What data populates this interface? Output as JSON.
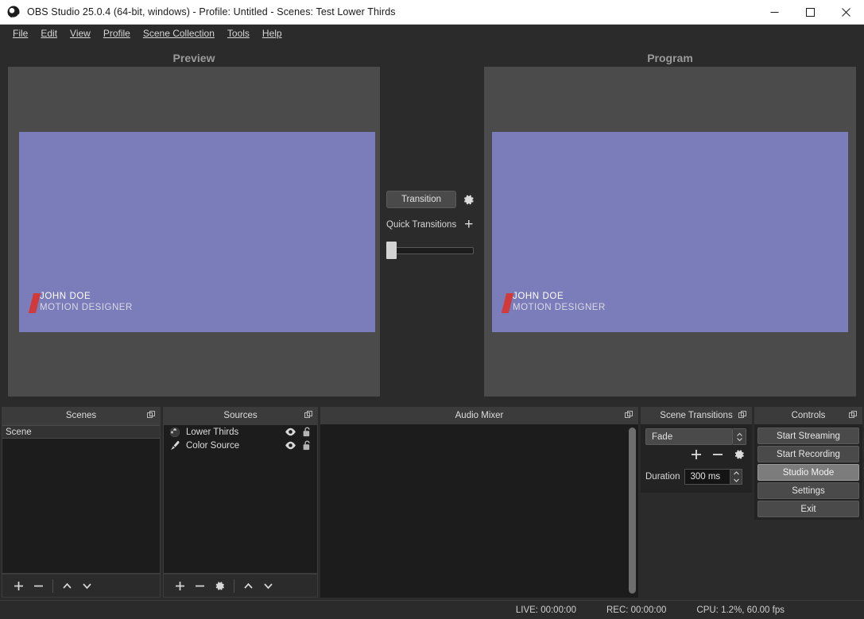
{
  "window": {
    "title": "OBS Studio 25.0.4 (64-bit, windows) - Profile: Untitled - Scenes: Test Lower Thirds",
    "logo_icon": "obs-logo-icon",
    "minimize_label": "─",
    "maximize_label": "□",
    "close_label": "✕"
  },
  "menu": {
    "items": [
      {
        "label": "File"
      },
      {
        "label": "Edit"
      },
      {
        "label": "View"
      },
      {
        "label": "Profile"
      },
      {
        "label": "Scene Collection"
      },
      {
        "label": "Tools"
      },
      {
        "label": "Help"
      }
    ]
  },
  "studio": {
    "preview_label": "Preview",
    "program_label": "Program",
    "canvas_color": "#7b7cba",
    "lower_third": {
      "name": "JOHN DOE",
      "role": "MOTION DESIGNER",
      "accent_color": "#d13a3a"
    }
  },
  "transition_center": {
    "transition_button": "Transition",
    "settings_icon": "gear-icon",
    "quick_transitions_label": "Quick Transitions",
    "add_icon": "plus-icon",
    "tbar_value": 0
  },
  "scenes": {
    "title": "Scenes",
    "float_icon": "undock-icon",
    "items": [
      {
        "label": "Scene",
        "selected": true
      }
    ],
    "toolbar": {
      "add": "+",
      "remove": "−",
      "move_up": "up-chevron-icon",
      "move_down": "down-chevron-icon"
    }
  },
  "sources": {
    "title": "Sources",
    "float_icon": "undock-icon",
    "items": [
      {
        "label": "Lower Thirds",
        "icon": "globe-icon",
        "visible": true,
        "locked": false
      },
      {
        "label": "Color Source",
        "icon": "brush-icon",
        "visible": true,
        "locked": false
      }
    ],
    "toolbar": {
      "add": "+",
      "remove": "−",
      "properties": "gear-icon",
      "move_up": "up-chevron-icon",
      "move_down": "down-chevron-icon"
    }
  },
  "mixer": {
    "title": "Audio Mixer",
    "float_icon": "undock-icon"
  },
  "scene_transitions": {
    "title": "Scene Transitions",
    "float_icon": "undock-icon",
    "selected": "Fade",
    "add_icon": "plus-icon",
    "remove_icon": "minus-icon",
    "properties_icon": "gear-icon",
    "duration_label": "Duration",
    "duration_value": "300 ms"
  },
  "controls": {
    "title": "Controls",
    "float_icon": "undock-icon",
    "buttons": [
      {
        "label": "Start Streaming",
        "active": false
      },
      {
        "label": "Start Recording",
        "active": false
      },
      {
        "label": "Studio Mode",
        "active": true
      },
      {
        "label": "Settings",
        "active": false
      },
      {
        "label": "Exit",
        "active": false
      }
    ]
  },
  "status": {
    "live": "LIVE: 00:00:00",
    "rec": "REC: 00:00:00",
    "cpu": "CPU: 1.2%, 60.00 fps"
  }
}
